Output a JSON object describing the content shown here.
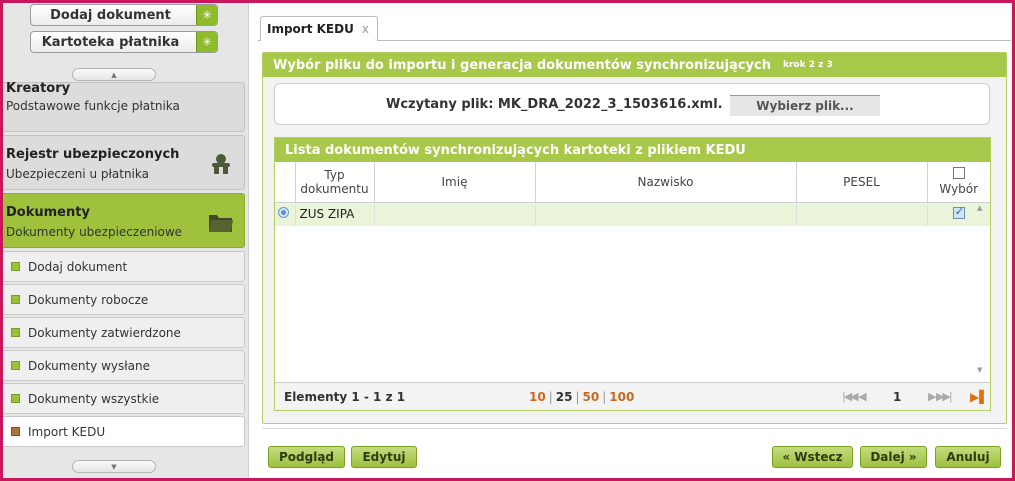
{
  "sidebar": {
    "top_buttons": [
      {
        "label": "Dodaj dokument",
        "icon": "sparkle-icon"
      },
      {
        "label": "Kartoteka płatnika",
        "icon": "sparkle-icon"
      }
    ],
    "sections": [
      {
        "title": "Kreatory",
        "subtitle": "Podstawowe funkcje płatnika"
      },
      {
        "title": "Rejestr ubezpieczonych",
        "subtitle": "Ubezpieczeni u płatnika",
        "icon": "people-icon"
      },
      {
        "title": "Dokumenty",
        "subtitle": "Dokumenty ubezpieczeniowe",
        "icon": "folder-icon",
        "active": true
      }
    ],
    "items": [
      {
        "label": "Dodaj dokument"
      },
      {
        "label": "Dokumenty robocze"
      },
      {
        "label": "Dokumenty zatwierdzone"
      },
      {
        "label": "Dokumenty wysłane"
      },
      {
        "label": "Dokumenty wszystkie"
      },
      {
        "label": "Import KEDU",
        "active": true
      }
    ]
  },
  "tab": {
    "label": "Import KEDU",
    "close": "x"
  },
  "panel": {
    "title": "Wybór pliku do importu i generacja dokumentów synchronizujących",
    "step": "krok 2 z 3",
    "file_label": "Wczytany plik: MK_DRA_2022_3_1503616.xml.",
    "file_button": "Wybierz plik..."
  },
  "list": {
    "title": "Lista dokumentów synchronizujących kartoteki z plikiem KEDU",
    "columns": [
      "Typ dokumentu",
      "Imię",
      "Nazwisko",
      "PESEL",
      "Wybór"
    ],
    "rows": [
      {
        "typ": "ZUS ZIPA",
        "imie": "",
        "nazwisko": "",
        "pesel": "",
        "selected": true
      }
    ],
    "footer": {
      "count": "Elementy 1 - 1 z 1",
      "page_sizes": [
        "10",
        "25",
        "50",
        "100"
      ],
      "current_size": "25",
      "page": "1"
    }
  },
  "buttons": {
    "preview": "Podgląd",
    "edit": "Edytuj",
    "back": "« Wstecz",
    "next": "Dalej »",
    "cancel": "Anuluj"
  },
  "colors": {
    "accent_green": "#a8c84a",
    "frame": "#c8175a",
    "page_link": "#c86a1d"
  }
}
